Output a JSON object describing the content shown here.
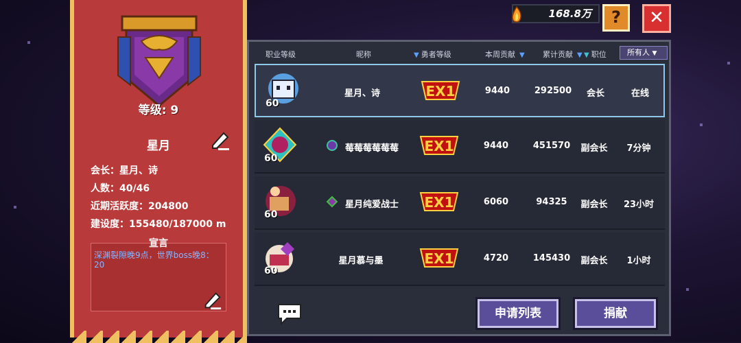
{
  "topbar": {
    "coins": "168.8万",
    "help_label": "?",
    "close_label": "✕"
  },
  "guild": {
    "level_label": "等级: 9",
    "name": "星月",
    "leader": "会长：星月、诗",
    "members": "人数：40/46",
    "activity": "近期活跃度：204800",
    "construction": "建设度：155480/187000 m",
    "declaration_title": "宣言",
    "declaration_text": "深渊裂隙晚9点，世界boss晚8：20"
  },
  "table": {
    "headers": [
      "职业等级",
      "昵称",
      "勇者等级",
      "本周贡献",
      "累计贡献",
      "职位"
    ],
    "filter": "所有人",
    "rows": [
      {
        "level": "60",
        "name": "星月、诗",
        "rank": "EX1",
        "week": "9440",
        "total": "292500",
        "role": "会长",
        "status": "在线"
      },
      {
        "level": "60",
        "name": "莓莓莓莓莓莓",
        "rank": "EX1",
        "week": "9440",
        "total": "451570",
        "role": "副会长",
        "status": "7分钟"
      },
      {
        "level": "60",
        "name": "星月纯爱战士",
        "rank": "EX1",
        "week": "6060",
        "total": "94325",
        "role": "副会长",
        "status": "23小时"
      },
      {
        "level": "60",
        "name": "星月慕与墨",
        "rank": "EX1",
        "week": "4720",
        "total": "145430",
        "role": "副会长",
        "status": "1小时"
      }
    ]
  },
  "buttons": {
    "apply_list": "申请列表",
    "donate": "捐献"
  },
  "colors": {
    "banner": "#b93a3a",
    "gold": "#f0c060",
    "panel": "#2a2d3a",
    "button": "#5a4d9a"
  }
}
